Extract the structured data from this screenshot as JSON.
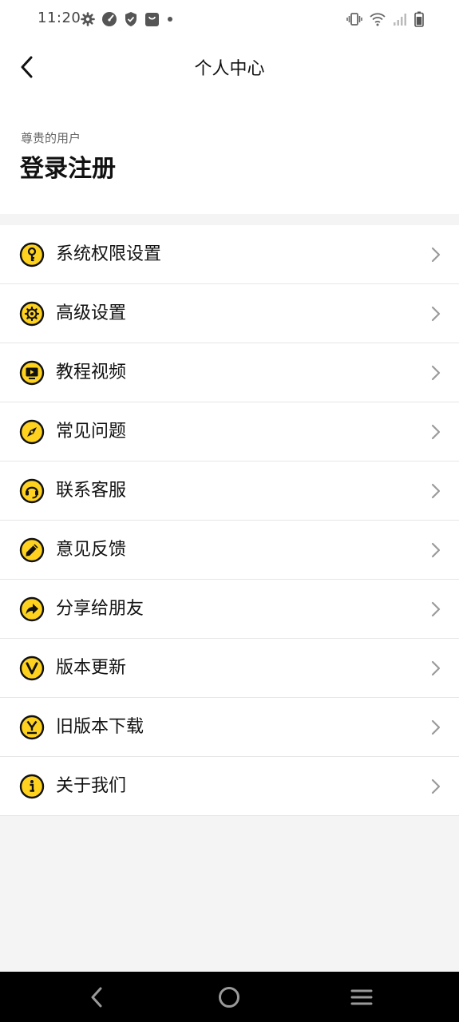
{
  "status_bar": {
    "time": "11:20"
  },
  "header": {
    "title": "个人中心"
  },
  "profile": {
    "subtitle": "尊贵的用户",
    "login_label": "登录注册"
  },
  "menu": {
    "items": [
      {
        "label": "系统权限设置",
        "icon": "key-icon"
      },
      {
        "label": "高级设置",
        "icon": "gear-icon"
      },
      {
        "label": "教程视频",
        "icon": "video-icon"
      },
      {
        "label": "常见问题",
        "icon": "compass-icon"
      },
      {
        "label": "联系客服",
        "icon": "customer-service-icon"
      },
      {
        "label": "意见反馈",
        "icon": "pencil-icon"
      },
      {
        "label": "分享给朋友",
        "icon": "share-icon"
      },
      {
        "label": "版本更新",
        "icon": "version-icon"
      },
      {
        "label": "旧版本下载",
        "icon": "download-icon"
      },
      {
        "label": "关于我们",
        "icon": "info-icon"
      }
    ]
  },
  "colors": {
    "accent": "#FFD21F",
    "icon_outline": "#111111",
    "background": "#F4F4F4",
    "nav_bar": "#000000"
  }
}
